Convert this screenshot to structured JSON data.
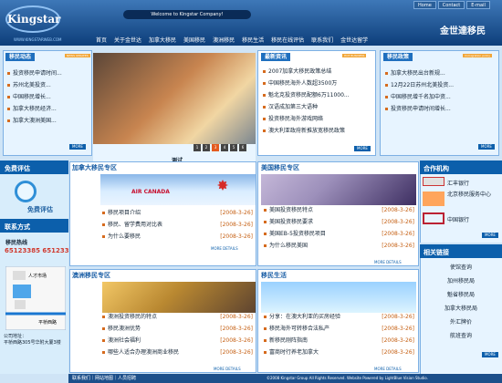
{
  "header": {
    "logo": "Kingstar",
    "welcome": "Welcome to Kingstar Company!",
    "site_url": "WWW.KINGSTARWEB.COM",
    "brand": "金世達移民",
    "top_links": [
      "Home",
      "Contact",
      "E-mail"
    ]
  },
  "nav": [
    "首页",
    "关于金世达",
    "加拿大移民",
    "美国移民",
    "澳洲移民",
    "移民生活",
    "移民在线评估",
    "联系我们",
    "金世达留学"
  ],
  "col1": {
    "title": "移民动态",
    "sub": "NEWS UPDATES",
    "items": [
      "投资移民申请时间...",
      "苏州北美投资...",
      "中国移民增长...",
      "加拿大移民经济...",
      "加拿大澳洲美国..."
    ],
    "more": "MORE"
  },
  "center": {
    "caption": "测试",
    "dots": [
      "1",
      "2",
      "3",
      "4",
      "5",
      "6"
    ]
  },
  "col3": {
    "title": "最新资讯",
    "sub": "HOT BUSINESS",
    "items": [
      "2007加拿大移民政策总结",
      "中国移民海外人数超3500万",
      "魁北克投资移民配额6万11000...",
      "汉语成加第三大语种",
      "投资移民海外游戏网络",
      "澳大利亚政府新推放宽移民政策"
    ],
    "more": "MORE"
  },
  "col4": {
    "title": "移民政策",
    "sub": "Immigration policy",
    "items": [
      "加拿大移民出台新规...",
      "12月22日苏州北美投资...",
      "中国移民增千名加中资...",
      "投资移民申请时间增长..."
    ],
    "more": "MORE"
  },
  "left_panel": {
    "eval": "免费评估",
    "eval_text": "免费评估",
    "contact": "联系方式",
    "hotline": "移民热线",
    "phones": "65123385 65123386",
    "address": "公司地址：\n平桥西路305号华附大厦3楼"
  },
  "canada": {
    "title": "加拿大移民专区",
    "items": [
      {
        "t": "移民项目介绍",
        "d": "[2008-3-26]"
      },
      {
        "t": "移民、留学费用对比表",
        "d": "[2008-3-26]"
      },
      {
        "t": "为什么要移民",
        "d": "[2008-3-26]"
      }
    ],
    "more": "MORE DETAILS",
    "airline": "AIR CANADA"
  },
  "usa": {
    "title": "美国移民专区",
    "items": [
      {
        "t": "美国投资移民特点",
        "d": "[2008-3-26]"
      },
      {
        "t": "美国投资移民要求",
        "d": "[2008-3-26]"
      },
      {
        "t": "美国EB-5投资移民项目",
        "d": "[2008-3-26]"
      },
      {
        "t": "为什么移民美国",
        "d": "[2008-3-26]"
      }
    ],
    "more": "MORE DETAILS"
  },
  "australia": {
    "title": "澳洲移民专区",
    "items": [
      {
        "t": "澳洲投资移民的特点",
        "d": "[2008-3-26]"
      },
      {
        "t": "移民澳洲优势",
        "d": "[2008-3-26]"
      },
      {
        "t": "澳洲社会福利",
        "d": "[2008-3-26]"
      },
      {
        "t": "哪些人适合办理澳洲商业移民",
        "d": "[2008-3-26]"
      }
    ],
    "more": "MORE DETAILS"
  },
  "life": {
    "title": "移民生活",
    "items": [
      {
        "t": "分享：在澳大利亚的买房经验",
        "d": "[2008-3-26]"
      },
      {
        "t": "移民海外可转移合法私产",
        "d": "[2008-3-26]"
      },
      {
        "t": "新移民刚阵指南",
        "d": "[2008-3-26]"
      },
      {
        "t": "富商时行养老加拿大",
        "d": "[2008-3-26]"
      }
    ],
    "more": "MORE DETAILS"
  },
  "partners": {
    "title": "合作机构",
    "items": [
      "汇丰银行",
      "北京移民服务中心",
      "中国银行"
    ],
    "more": "MORE"
  },
  "links": {
    "title": "相关链接",
    "items": [
      "使馆查询",
      "加州移民局",
      "魁省移民局",
      "加拿大移民局",
      "外汇牌价",
      "航班查询"
    ],
    "more": "MORE"
  },
  "footer": {
    "left": "联系我们｜网站地图｜人员招聘",
    "right": "©2008 Kingstar Group All Rights Reserved. Website Powered by LightBlue Vision Studio."
  },
  "map": {
    "labels": [
      "人才市场",
      "平桥西路"
    ]
  }
}
